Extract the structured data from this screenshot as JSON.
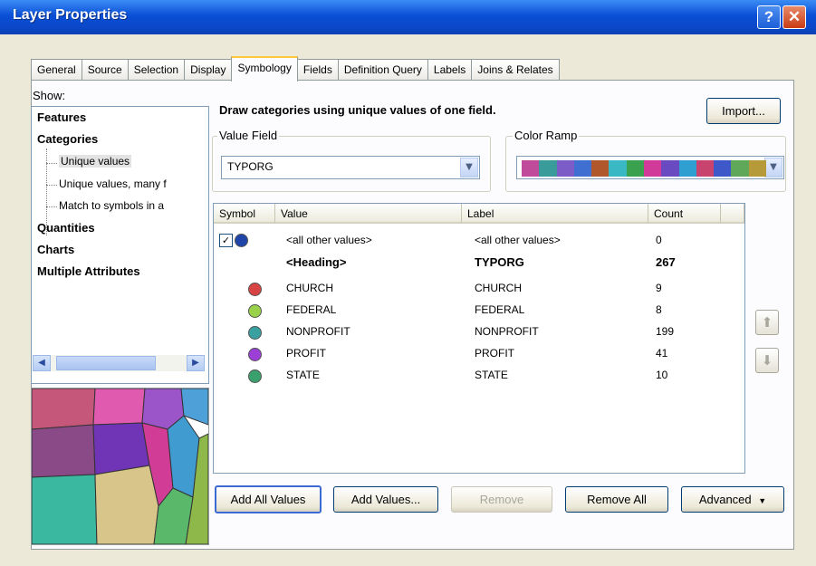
{
  "window": {
    "title": "Layer Properties",
    "help_label": "?",
    "close_label": "✕"
  },
  "tabs": [
    {
      "label": "General"
    },
    {
      "label": "Source"
    },
    {
      "label": "Selection"
    },
    {
      "label": "Display"
    },
    {
      "label": "Symbology",
      "active": true
    },
    {
      "label": "Fields"
    },
    {
      "label": "Definition Query"
    },
    {
      "label": "Labels"
    },
    {
      "label": "Joins & Relates"
    }
  ],
  "show": {
    "label": "Show:",
    "items": [
      "Features",
      "Categories",
      "Unique values",
      "Unique values, many f",
      "Match to symbols in a",
      "Quantities",
      "Charts",
      "Multiple Attributes"
    ]
  },
  "description": "Draw categories using unique values of one field.",
  "import_label": "Import...",
  "value_field": {
    "label": "Value Field",
    "value": "TYPORG"
  },
  "color_ramp": {
    "label": "Color Ramp",
    "colors": [
      "#c04b9a",
      "#3a9c9a",
      "#7c5cc6",
      "#3f6fd1",
      "#b0572b",
      "#3ab8c4",
      "#3aa24f",
      "#d23a9a",
      "#6a4ac0",
      "#2f9fd2",
      "#c9436f",
      "#3e58c9",
      "#5fa85a",
      "#b69a3a"
    ]
  },
  "grid": {
    "headers": {
      "symbol": "Symbol",
      "value": "Value",
      "label": "Label",
      "count": "Count"
    },
    "rows": [
      {
        "checked": true,
        "color": "#1f45a8",
        "value": "<all other values>",
        "label": "<all other values>",
        "count": "0"
      },
      {
        "heading": true,
        "value": "<Heading>",
        "label": "TYPORG",
        "count": "267"
      },
      {
        "color": "#d84444",
        "value": "CHURCH",
        "label": "CHURCH",
        "count": "9"
      },
      {
        "color": "#9ad14a",
        "value": "FEDERAL",
        "label": "FEDERAL",
        "count": "8"
      },
      {
        "color": "#3aa0a0",
        "value": "NONPROFIT",
        "label": "NONPROFIT",
        "count": "199"
      },
      {
        "color": "#9b3fd6",
        "value": "PROFIT",
        "label": "PROFIT",
        "count": "41"
      },
      {
        "color": "#3aa06e",
        "value": "STATE",
        "label": "STATE",
        "count": "10"
      }
    ]
  },
  "buttons": {
    "add_all": "Add All Values",
    "add_values": "Add Values...",
    "remove": "Remove",
    "remove_all": "Remove All",
    "advanced": "Advanced"
  },
  "icons": {
    "up": "up-arrow-icon",
    "down": "down-arrow-icon",
    "dropdown": "chevron-down-icon",
    "check": "check-icon"
  }
}
